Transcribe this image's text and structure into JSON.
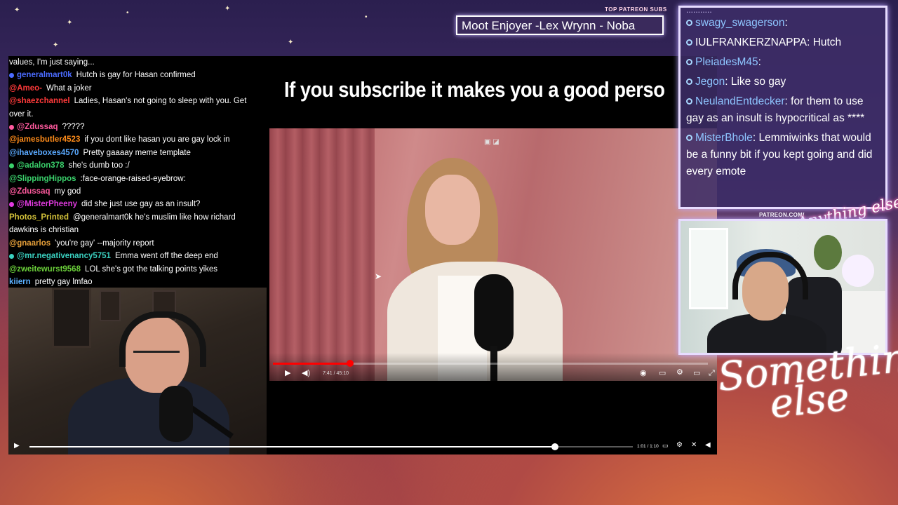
{
  "top_subs": {
    "label": "TOP PATREON SUBS",
    "ticker": "Moot Enjoyer -Lex Wrynn -  Noba"
  },
  "stream_chat": [
    {
      "user": "",
      "text": "values, I'm just saying...",
      "color": "#ffffff"
    },
    {
      "user": "generalmart0k",
      "text": "Hutch is gay for Hasan confirmed",
      "color": "#4b6cff"
    },
    {
      "user": "@Ameo-",
      "text": "What a joker",
      "color": "#ff3a3a"
    },
    {
      "user": "@shaezchannel",
      "text": "Ladies, Hasan's not going to sleep with you. Get over it.",
      "color": "#ff3a3a"
    },
    {
      "user": "@Zdussaq",
      "text": "?????",
      "color": "#ff5a9e"
    },
    {
      "user": "@jamesbutler4523",
      "text": "if you dont like hasan you are gay lock in",
      "color": "#ff8c1a"
    },
    {
      "user": "@ihaveboxes4570",
      "text": "Pretty gaaaay meme template",
      "color": "#5aa9ff"
    },
    {
      "user": "@adalon378",
      "text": "she's dumb too :/",
      "color": "#3ad06b"
    },
    {
      "user": "@SlippingHippos",
      "text": ":face-orange-raised-eyebrow:",
      "color": "#3ad06b"
    },
    {
      "user": "@Zdussaq",
      "text": "my god",
      "color": "#ff5a9e"
    },
    {
      "user": "@MisterPheeny",
      "text": "did she just use gay as an insult?",
      "color": "#e03adf"
    },
    {
      "user": "Photos_Printed",
      "text": "@generalmart0k he's muslim like how richard dawkins is christian",
      "color": "#d4c23a"
    },
    {
      "user": "@gnaarlos",
      "text": "'you're gay' --majority report",
      "color": "#e8a13a"
    },
    {
      "user": "@mr.negativenancy5751",
      "text": "Emma went off the deep end",
      "color": "#3ad0c0"
    },
    {
      "user": "@zweitewurst9568",
      "text": "LOL she's got the talking points yikes",
      "color": "#6bd03a"
    },
    {
      "user": "kiiern",
      "text": "pretty gay lmfao",
      "color": "#5ab0ff"
    }
  ],
  "inner_video": {
    "caption": "If you subscribe it makes you a good perso",
    "time": "7:41 / 45:10",
    "progress": 0.177
  },
  "outer_player": {
    "time": "1:01 / 1:10",
    "progress": 0.871
  },
  "twitch_chat": {
    "header": "...........",
    "messages": [
      {
        "user": "swagy_swagerson",
        "text": "",
        "user_color": "#8ec5ff"
      },
      {
        "user": "IULFRANKERZNAPPA",
        "text": "Hutch",
        "user_color": "#ffffff"
      },
      {
        "user": "PleiadesM45",
        "text": "",
        "user_color": "#8ec5ff"
      },
      {
        "user": "Jegon",
        "text": "Like so gay",
        "user_color": "#8ec5ff"
      },
      {
        "user": "NeulandEntdecker",
        "text": "for them to use gay as an insult is hypocritical as ****",
        "user_color": "#8ec5ff"
      },
      {
        "user": "MisterBhole",
        "text": "Lemmiwinks that would be a funny bit if you kept going and did every emote",
        "user_color": "#8ec5ff"
      }
    ]
  },
  "patreon": {
    "url_label": "PATREON.COM/",
    "logo_text": "Anything else?"
  },
  "brand": {
    "line1": "Something",
    "line2": "else"
  }
}
